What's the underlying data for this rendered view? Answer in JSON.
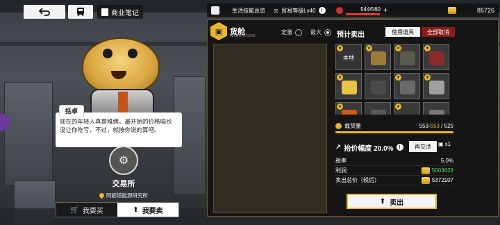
{
  "toolbar": {
    "back_icon": "back-arrow-icon",
    "train_icon": "train-icon",
    "notes_label": "商业笔记"
  },
  "dialog": {
    "speaker": "括卓",
    "text": "现在的年轻人真是难缠。最开始的价格咱也没让你吃亏，不过，就按你说的算吧。"
  },
  "station": {
    "name": "交易所",
    "location": "阿妮塔能源研究所"
  },
  "tabs": {
    "buy_label": "我要买",
    "sell_label": "我要卖"
  },
  "status": {
    "skills_label": "生活技能总览",
    "trade_level": "贸易等级Lv40",
    "fatigue": "544/560",
    "fatigue_fraction": 0.971,
    "money": "85726"
  },
  "cargo": {
    "title": "货舱",
    "subtitle": "WAREHOUSE",
    "mode_fixed": "定量",
    "mode_max": "最大"
  },
  "sell": {
    "title": "预计卖出",
    "use_item_label": "使用道具",
    "cancel_all_label": "全部取消",
    "grid": [
      {
        "star": true,
        "label": "本地",
        "color": "#333"
      },
      {
        "star": true,
        "label": "",
        "color": "#9c7a3a"
      },
      {
        "star": true,
        "label": "",
        "color": "#5a5a4a"
      },
      {
        "star": true,
        "label": "",
        "color": "#8a2a2a"
      },
      {
        "star": true,
        "label": "",
        "color": "#e8c44a"
      },
      {
        "star": false,
        "label": "",
        "color": "#4a4a4a"
      },
      {
        "star": true,
        "label": "",
        "color": "#6a6a6a"
      },
      {
        "star": true,
        "label": "",
        "color": "#a0a0a0"
      },
      {
        "star": true,
        "label": "",
        "color": "#d05a1a"
      },
      {
        "star": false,
        "label": "",
        "color": "#5a5a5a"
      },
      {
        "star": true,
        "label": "",
        "color": "#3a3a3a"
      },
      {
        "star": false,
        "label": "",
        "color": "#777"
      }
    ],
    "load_label": "载货量",
    "load_current": "553",
    "load_after": "553",
    "load_max": "525",
    "load_fraction": 1.0,
    "premium_label": "抬价幅度 20.0%",
    "exchange_label": "再交涉",
    "exchange_count": "x1",
    "tax_label": "税率",
    "tax_value": "5.0%",
    "profit_label": "利润",
    "profit_value": "5003628",
    "total_label": "卖出总价（税后）",
    "total_value": "5372107",
    "sell_button": "卖出"
  }
}
